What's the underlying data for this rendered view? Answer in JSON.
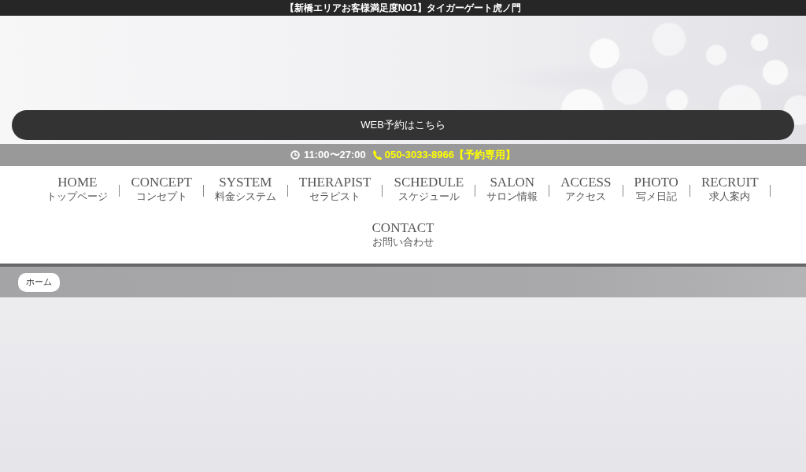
{
  "top_bar": {
    "title": "【新橋エリアお客様満足度NO1】タイガーゲート虎ノ門"
  },
  "reserve_button": {
    "label": "WEB予約はこちら"
  },
  "info_bar": {
    "hours": "11:00〜27:00",
    "phone": "050-3033-8966【予約専用】"
  },
  "nav": {
    "items": [
      {
        "title": "HOME",
        "subtitle": "トップページ"
      },
      {
        "title": "CONCEPT",
        "subtitle": "コンセプト"
      },
      {
        "title": "SYSTEM",
        "subtitle": "料金システム"
      },
      {
        "title": "THERAPIST",
        "subtitle": "セラピスト"
      },
      {
        "title": "SCHEDULE",
        "subtitle": "スケジュール"
      },
      {
        "title": "SALON",
        "subtitle": "サロン情報"
      },
      {
        "title": "ACCESS",
        "subtitle": "アクセス"
      },
      {
        "title": "PHOTO",
        "subtitle": "写メ日記"
      },
      {
        "title": "RECRUIT",
        "subtitle": "求人案内"
      },
      {
        "title": "CONTACT",
        "subtitle": "お問い合わせ"
      }
    ]
  },
  "breadcrumb": {
    "items": [
      {
        "label": "ホーム"
      }
    ]
  }
}
